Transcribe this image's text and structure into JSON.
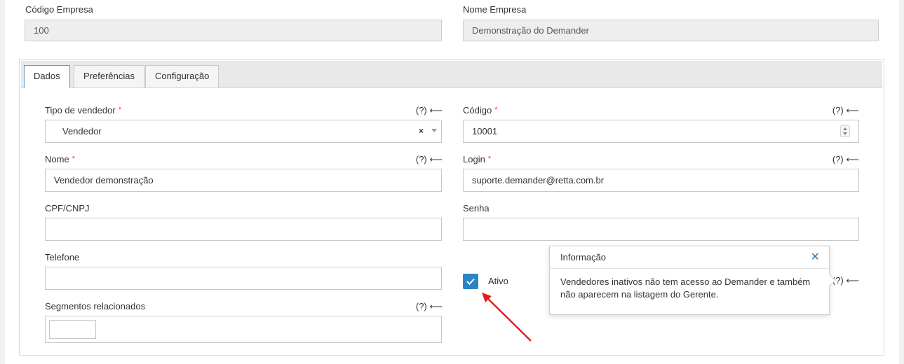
{
  "company": {
    "code_label": "Código Empresa",
    "code_value": "100",
    "name_label": "Nome Empresa",
    "name_value": "Demonstração do Demander"
  },
  "tabs": [
    {
      "label": "Dados",
      "active": true
    },
    {
      "label": "Preferências",
      "active": false
    },
    {
      "label": "Configuração",
      "active": false
    }
  ],
  "help_text": "(?) ⟵",
  "form": {
    "tipo_label": "Tipo de vendedor",
    "tipo_value": "Vendedor",
    "codigo_label": "Código",
    "codigo_value": "10001",
    "nome_label": "Nome",
    "nome_value": "Vendedor demonstração",
    "login_label": "Login",
    "login_value": "suporte.demander@retta.com.br",
    "cpf_label": "CPF/CNPJ",
    "cpf_value": "",
    "senha_label": "Senha",
    "senha_value": "",
    "telefone_label": "Telefone",
    "telefone_value": "",
    "ativo_label": "Ativo",
    "ativo_checked": true,
    "segmentos_label": "Segmentos relacionados",
    "required_mark": "*"
  },
  "popover": {
    "title": "Informação",
    "body": "Vendedores inativos não tem acesso ao Demander e também não aparecem na listagem do Gerente."
  },
  "colors": {
    "accent": "#2a85c8",
    "required": "#e04040",
    "annotation_arrow": "#e02020"
  }
}
